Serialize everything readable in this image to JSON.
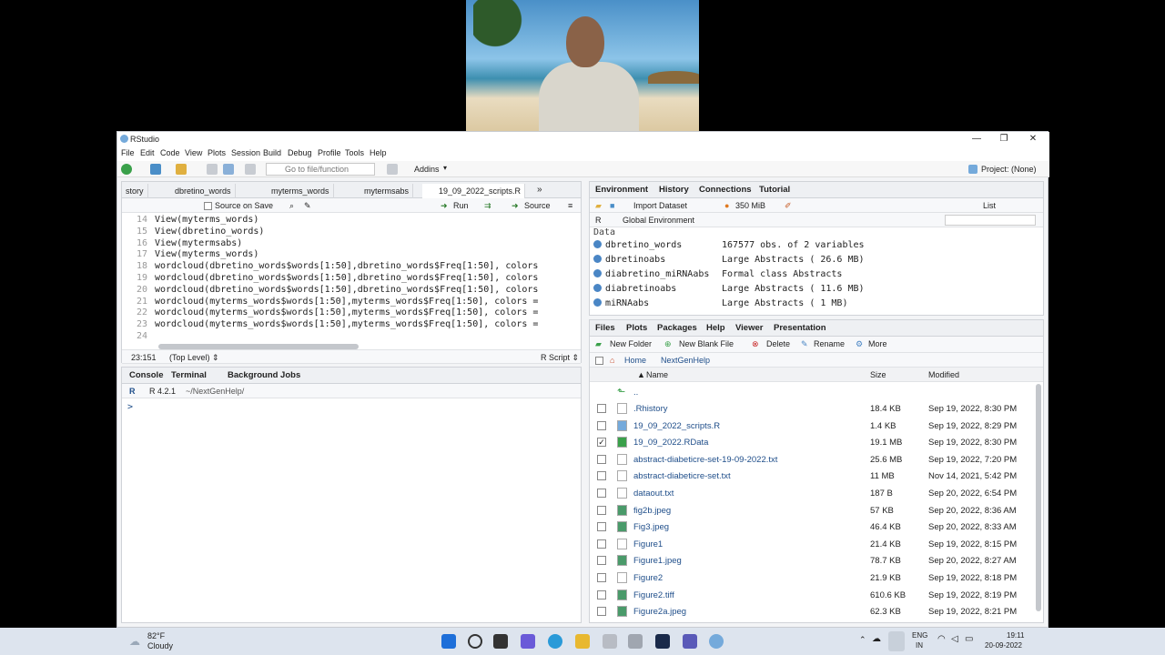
{
  "window": {
    "title": "RStudio",
    "minimize": "—",
    "restore": "❐",
    "close": "✕"
  },
  "menu": [
    "File",
    "Edit",
    "Code",
    "View",
    "Plots",
    "Session",
    "Build",
    "Debug",
    "Profile",
    "Tools",
    "Help"
  ],
  "toolbar": {
    "goto_placeholder": "Go to file/function",
    "addins": "Addins",
    "project": "Project: (None)"
  },
  "editor": {
    "tabs": [
      "story",
      "dbretino_words",
      "myterms_words",
      "mytermsabs",
      "19_09_2022_scripts.R"
    ],
    "source_on_save": "Source on Save",
    "run": "Run",
    "source": "Source",
    "lines": [
      {
        "n": "14",
        "code": "View(myterms_words)"
      },
      {
        "n": "15",
        "code": "View(dbretino_words)"
      },
      {
        "n": "16",
        "code": "View(mytermsabs)"
      },
      {
        "n": "17",
        "code": "View(myterms_words)"
      },
      {
        "n": "18",
        "code": "wordcloud(dbretino_words$words[1:50],dbretino_words$Freq[1:50], colors"
      },
      {
        "n": "19",
        "code": "wordcloud(dbretino_words$words[1:50],dbretino_words$Freq[1:50], colors"
      },
      {
        "n": "20",
        "code": "wordcloud(dbretino_words$words[1:50],dbretino_words$Freq[1:50], colors"
      },
      {
        "n": "21",
        "code": "wordcloud(myterms_words$words[1:50],myterms_words$Freq[1:50], colors ="
      },
      {
        "n": "22",
        "code": "wordcloud(myterms_words$words[1:50],myterms_words$Freq[1:50], colors ="
      },
      {
        "n": "23",
        "code": "wordcloud(myterms_words$words[1:50],myterms_words$Freq[1:50], colors ="
      },
      {
        "n": "24",
        "code": ""
      }
    ],
    "status_pos": "23:151",
    "status_scope": "(Top Level) ⇕",
    "status_type": "R Script ⇕"
  },
  "console": {
    "tabs": [
      "Console",
      "Terminal",
      "Background Jobs"
    ],
    "version": "R 4.2.1",
    "path": "~/NextGenHelp/",
    "prompt": ">"
  },
  "environment": {
    "tabs": [
      "Environment",
      "History",
      "Connections",
      "Tutorial"
    ],
    "import_dataset": "Import Dataset",
    "memory": "350 MiB",
    "list_label": "List",
    "lang": "R",
    "scope": "Global Environment",
    "section": "Data",
    "rows": [
      {
        "name": "dbretino_words",
        "value": "167577 obs. of 2 variables"
      },
      {
        "name": "dbretinoabs",
        "value": "Large Abstracts ( 26.6 MB)"
      },
      {
        "name": "diabretino_miRNAabs",
        "value": "Formal class  Abstracts"
      },
      {
        "name": "diabretinoabs",
        "value": "Large Abstracts ( 11.6 MB)"
      },
      {
        "name": "miRNAabs",
        "value": "Large Abstracts ( 1 MB)"
      }
    ]
  },
  "files": {
    "tabs": [
      "Files",
      "Plots",
      "Packages",
      "Help",
      "Viewer",
      "Presentation"
    ],
    "new_folder": "New Folder",
    "new_blank_file": "New Blank File",
    "delete": "Delete",
    "rename": "Rename",
    "more": "More",
    "crumb_home": "Home",
    "crumb_dir": "NextGenHelp",
    "col_name": "Name",
    "col_size": "Size",
    "col_modified": "Modified",
    "up": "..",
    "rows": [
      {
        "name": ".Rhistory",
        "size": "18.4 KB",
        "modified": "Sep 19, 2022, 8:30 PM",
        "checked": ""
      },
      {
        "name": "19_09_2022_scripts.R",
        "size": "1.4 KB",
        "modified": "Sep 19, 2022, 8:29 PM",
        "checked": ""
      },
      {
        "name": "19_09_2022.RData",
        "size": "19.1 MB",
        "modified": "Sep 19, 2022, 8:30 PM",
        "checked": "✓"
      },
      {
        "name": "abstract-diabeticre-set-19-09-2022.txt",
        "size": "25.6 MB",
        "modified": "Sep 19, 2022, 7:20 PM",
        "checked": ""
      },
      {
        "name": "abstract-diabeticre-set.txt",
        "size": "11 MB",
        "modified": "Nov 14, 2021, 5:42 PM",
        "checked": ""
      },
      {
        "name": "dataout.txt",
        "size": "187 B",
        "modified": "Sep 20, 2022, 6:54 PM",
        "checked": ""
      },
      {
        "name": "fig2b.jpeg",
        "size": "57 KB",
        "modified": "Sep 20, 2022, 8:36 AM",
        "checked": ""
      },
      {
        "name": "Fig3.jpeg",
        "size": "46.4 KB",
        "modified": "Sep 20, 2022, 8:33 AM",
        "checked": ""
      },
      {
        "name": "Figure1",
        "size": "21.4 KB",
        "modified": "Sep 19, 2022, 8:15 PM",
        "checked": ""
      },
      {
        "name": "Figure1.jpeg",
        "size": "78.7 KB",
        "modified": "Sep 20, 2022, 8:27 AM",
        "checked": ""
      },
      {
        "name": "Figure2",
        "size": "21.9 KB",
        "modified": "Sep 19, 2022, 8:18 PM",
        "checked": ""
      },
      {
        "name": "Figure2.tiff",
        "size": "610.6 KB",
        "modified": "Sep 19, 2022, 8:19 PM",
        "checked": ""
      },
      {
        "name": "Figure2a.jpeg",
        "size": "62.3 KB",
        "modified": "Sep 19, 2022, 8:21 PM",
        "checked": ""
      }
    ]
  },
  "taskbar": {
    "weather_temp": "82°F",
    "weather_desc": "Cloudy",
    "lang": "ENG",
    "region": "IN",
    "time": "19:11",
    "date": "20-09-2022"
  },
  "colors": {
    "accent": "#75aadb",
    "link": "#1f4e8a",
    "taskbar": "#dde4ee"
  }
}
